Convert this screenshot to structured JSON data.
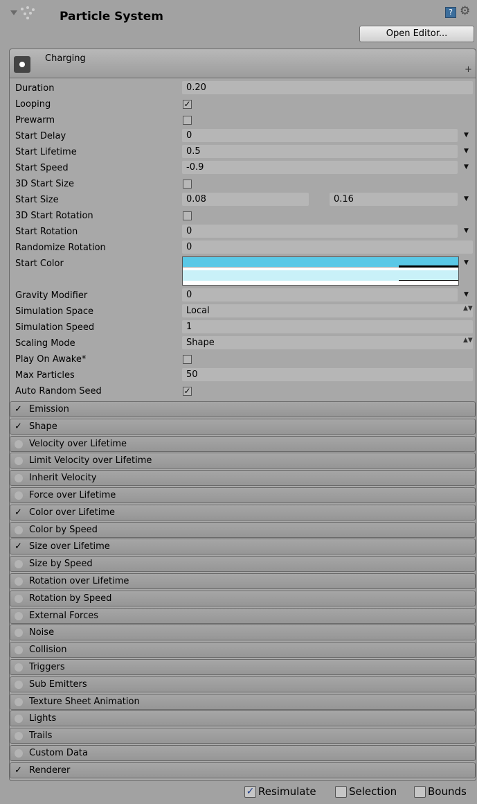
{
  "header": {
    "title": "Particle System",
    "open_editor_label": "Open Editor...",
    "help_icon_glyph": "?",
    "gear_icon_glyph": "⚙"
  },
  "system": {
    "name": "Charging",
    "plus_glyph": "+"
  },
  "properties": {
    "duration": {
      "label": "Duration",
      "value": "0.20"
    },
    "looping": {
      "label": "Looping",
      "checked": true
    },
    "prewarm": {
      "label": "Prewarm",
      "checked": false
    },
    "start_delay": {
      "label": "Start Delay",
      "value": "0"
    },
    "start_lifetime": {
      "label": "Start Lifetime",
      "value": "0.5"
    },
    "start_speed": {
      "label": "Start Speed",
      "value": "-0.9"
    },
    "three_d_start_size": {
      "label": "3D Start Size",
      "checked": false
    },
    "start_size": {
      "label": "Start Size",
      "min": "0.08",
      "max": "0.16"
    },
    "three_d_start_rotation": {
      "label": "3D Start Rotation",
      "checked": false
    },
    "start_rotation": {
      "label": "Start Rotation",
      "value": "0"
    },
    "randomize_rotation": {
      "label": "Randomize Rotation",
      "value": "0"
    },
    "start_color": {
      "label": "Start Color",
      "color_top": "#5ac8e6",
      "color_bottom": "#c9f1f8"
    },
    "gravity_modifier": {
      "label": "Gravity Modifier",
      "value": "0"
    },
    "simulation_space": {
      "label": "Simulation Space",
      "value": "Local"
    },
    "simulation_speed": {
      "label": "Simulation Speed",
      "value": "1"
    },
    "scaling_mode": {
      "label": "Scaling Mode",
      "value": "Shape"
    },
    "play_on_awake": {
      "label": "Play On Awake*",
      "checked": false
    },
    "max_particles": {
      "label": "Max Particles",
      "value": "50"
    },
    "auto_random_seed": {
      "label": "Auto Random Seed",
      "checked": true
    }
  },
  "modules": [
    {
      "label": "Emission",
      "enabled": true
    },
    {
      "label": "Shape",
      "enabled": true
    },
    {
      "label": "Velocity over Lifetime",
      "enabled": false
    },
    {
      "label": "Limit Velocity over Lifetime",
      "enabled": false
    },
    {
      "label": "Inherit Velocity",
      "enabled": false
    },
    {
      "label": "Force over Lifetime",
      "enabled": false
    },
    {
      "label": "Color over Lifetime",
      "enabled": true
    },
    {
      "label": "Color by Speed",
      "enabled": false
    },
    {
      "label": "Size over Lifetime",
      "enabled": true
    },
    {
      "label": "Size by Speed",
      "enabled": false
    },
    {
      "label": "Rotation over Lifetime",
      "enabled": false
    },
    {
      "label": "Rotation by Speed",
      "enabled": false
    },
    {
      "label": "External Forces",
      "enabled": false
    },
    {
      "label": "Noise",
      "enabled": false
    },
    {
      "label": "Collision",
      "enabled": false
    },
    {
      "label": "Triggers",
      "enabled": false
    },
    {
      "label": "Sub Emitters",
      "enabled": false
    },
    {
      "label": "Texture Sheet Animation",
      "enabled": false
    },
    {
      "label": "Lights",
      "enabled": false
    },
    {
      "label": "Trails",
      "enabled": false
    },
    {
      "label": "Custom Data",
      "enabled": false
    },
    {
      "label": "Renderer",
      "enabled": true
    }
  ],
  "footer": {
    "resimulate": {
      "label": "Resimulate",
      "checked": true
    },
    "selection": {
      "label": "Selection",
      "checked": false
    },
    "bounds": {
      "label": "Bounds",
      "checked": false
    }
  },
  "icons": {
    "check_glyph": "✓",
    "dropdown_glyph": "▼",
    "updown_glyph": "▲▼"
  }
}
